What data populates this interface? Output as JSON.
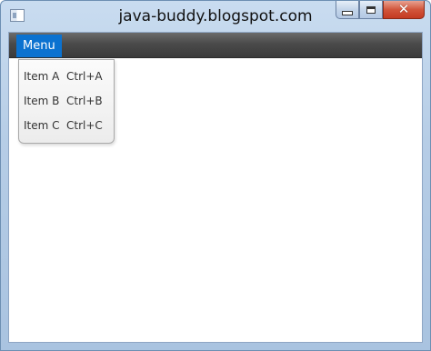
{
  "window": {
    "title": "java-buddy.blogspot.com",
    "close_symbol": "✕"
  },
  "menubar": {
    "menus": [
      {
        "label": "Menu"
      }
    ]
  },
  "dropdown": {
    "items": [
      {
        "label": "Item A",
        "accelerator": "Ctrl+A"
      },
      {
        "label": "Item B",
        "accelerator": "Ctrl+B"
      },
      {
        "label": "Item C",
        "accelerator": "Ctrl+C"
      }
    ]
  },
  "colors": {
    "menu_highlight": "#0b72d0",
    "menubar_dark": "#3b3b3b",
    "close_button": "#c43a22"
  },
  "icons": [
    "app-icon",
    "minimize-icon",
    "maximize-icon",
    "close-icon"
  ]
}
